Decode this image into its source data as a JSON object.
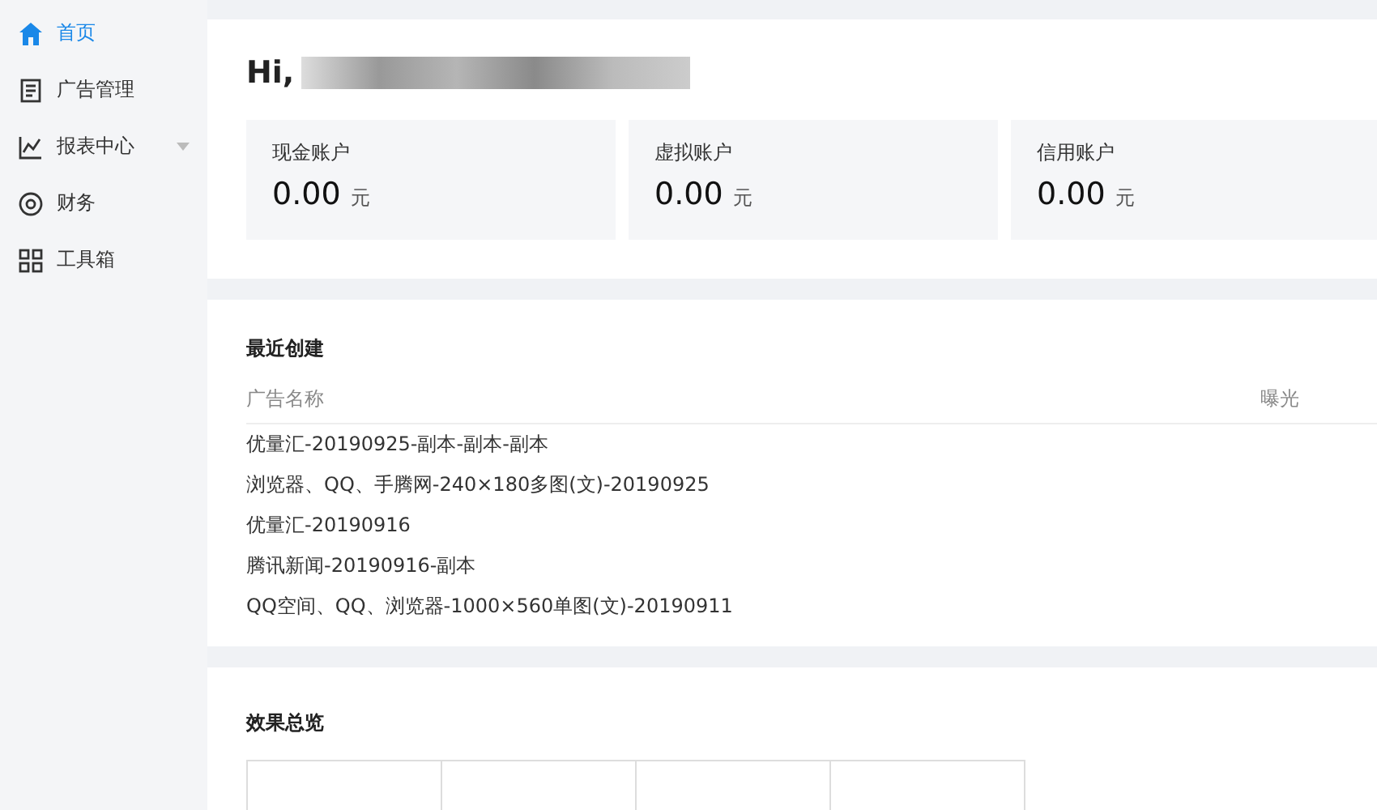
{
  "sidebar": {
    "items": [
      {
        "label": "首页",
        "selected": true,
        "expandable": false
      },
      {
        "label": "广告管理",
        "selected": false,
        "expandable": false
      },
      {
        "label": "报表中心",
        "selected": false,
        "expandable": true
      },
      {
        "label": "财务",
        "selected": false,
        "expandable": false
      },
      {
        "label": "工具箱",
        "selected": false,
        "expandable": false
      }
    ]
  },
  "greeting": {
    "text": "Hi,",
    "name_redacted": true
  },
  "accounts": [
    {
      "label": "现金账户",
      "amount": "0.00",
      "unit": "元"
    },
    {
      "label": "虚拟账户",
      "amount": "0.00",
      "unit": "元"
    },
    {
      "label": "信用账户",
      "amount": "0.00",
      "unit": "元"
    }
  ],
  "recent": {
    "title": "最近创建",
    "columns": [
      "广告名称",
      "曝光"
    ],
    "rows": [
      "优量汇-20190925-副本-副本-副本",
      "浏览器、QQ、手腾网-240×180多图(文)-20190925",
      "优量汇-20190916",
      "腾讯新闻-20190916-副本",
      "QQ空间、QQ、浏览器-1000×560单图(文)-20190911"
    ]
  },
  "overview": {
    "title": "效果总览"
  }
}
